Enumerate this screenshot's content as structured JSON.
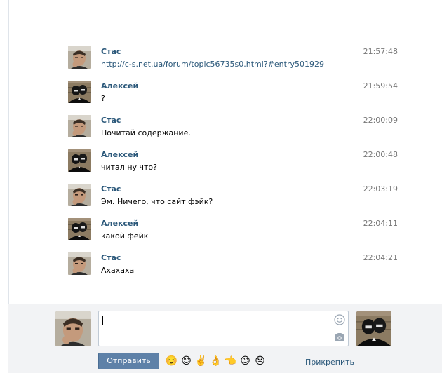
{
  "participants": {
    "me": {
      "name": "Стас"
    },
    "peer": {
      "name": "Алексей"
    }
  },
  "messages": [
    {
      "author": "Стас",
      "time": "21:57:48",
      "text": "http://c-s.net.ua/forum/topic56735s0.html?#entry501929",
      "is_link": true
    },
    {
      "author": "Алексей",
      "time": "21:59:54",
      "text": "?"
    },
    {
      "author": "Стас",
      "time": "22:00:09",
      "text": "Почитай содержание."
    },
    {
      "author": "Алексей",
      "time": "22:00:48",
      "text": "читал ну что?"
    },
    {
      "author": "Стас",
      "time": "22:03:19",
      "text": "Эм. Ничего, что сайт фэйк?"
    },
    {
      "author": "Алексей",
      "time": "22:04:11",
      "text": "какой фейк"
    },
    {
      "author": "Стас",
      "time": "22:04:21",
      "text": "Ахахаха"
    }
  ],
  "composer": {
    "input_value": "",
    "send_label": "Отправить",
    "attach_label": "Прикрепить",
    "smiles": [
      "☺️",
      "😊",
      "✌️",
      "👌",
      "👈",
      "😊",
      "😞"
    ],
    "icons": {
      "emoji_toggle": "smiley-icon",
      "camera": "camera-icon"
    }
  },
  "colors": {
    "link": "#2b587a",
    "button": "#5e81a8",
    "composer_bg": "#f2f3f5"
  }
}
